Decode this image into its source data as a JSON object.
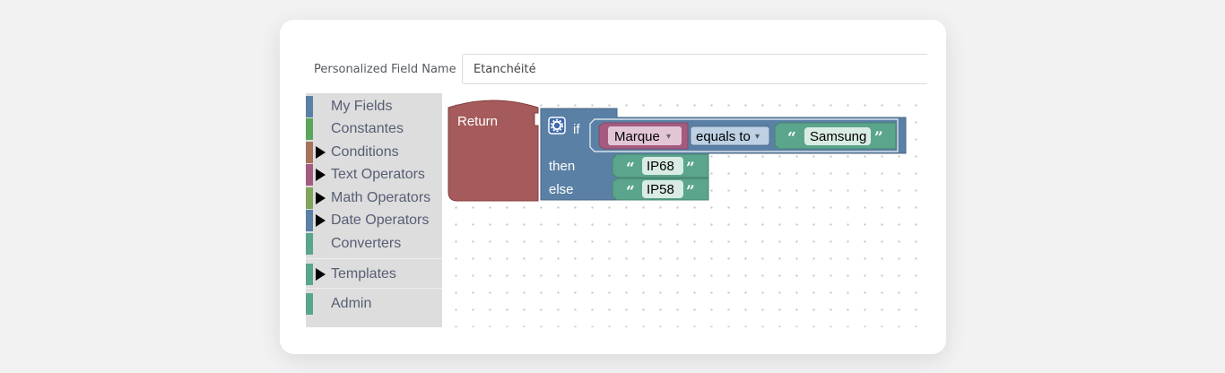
{
  "field": {
    "label": "Personalized Field Name",
    "value": "Etanchéité"
  },
  "toolbox": {
    "items": [
      {
        "label": "My Fields",
        "color": "#5b80a5",
        "expandable": false
      },
      {
        "label": "Constantes",
        "color": "#5ba55b",
        "expandable": false
      },
      {
        "label": "Conditions",
        "color": "#a5745b",
        "expandable": true
      },
      {
        "label": "Text Operators",
        "color": "#a55b80",
        "expandable": true
      },
      {
        "label": "Math Operators",
        "color": "#80a55b",
        "expandable": true
      },
      {
        "label": "Date Operators",
        "color": "#5b80a5",
        "expandable": true
      },
      {
        "label": "Converters",
        "color": "#5ba58c",
        "expandable": false
      },
      {
        "label": "Templates",
        "color": "#5ba58c",
        "expandable": true
      },
      {
        "label": "Admin",
        "color": "#5ba58c",
        "expandable": false
      }
    ]
  },
  "blocks": {
    "return_label": "Return",
    "if_label": "if",
    "then_label": "then",
    "else_label": "else",
    "field_dropdown": "Marque",
    "operator_dropdown": "equals to",
    "compare_text": "Samsung",
    "then_text": "IP68",
    "else_text": "IP58",
    "open_quote": "“",
    "close_quote": "”",
    "dropdown_arrow": "▾",
    "colors": {
      "return": "#a55b5b",
      "logic": "#5b80a5",
      "text": "#5ba58c",
      "field": "#a55b80",
      "operator": "#5b80a5"
    }
  }
}
